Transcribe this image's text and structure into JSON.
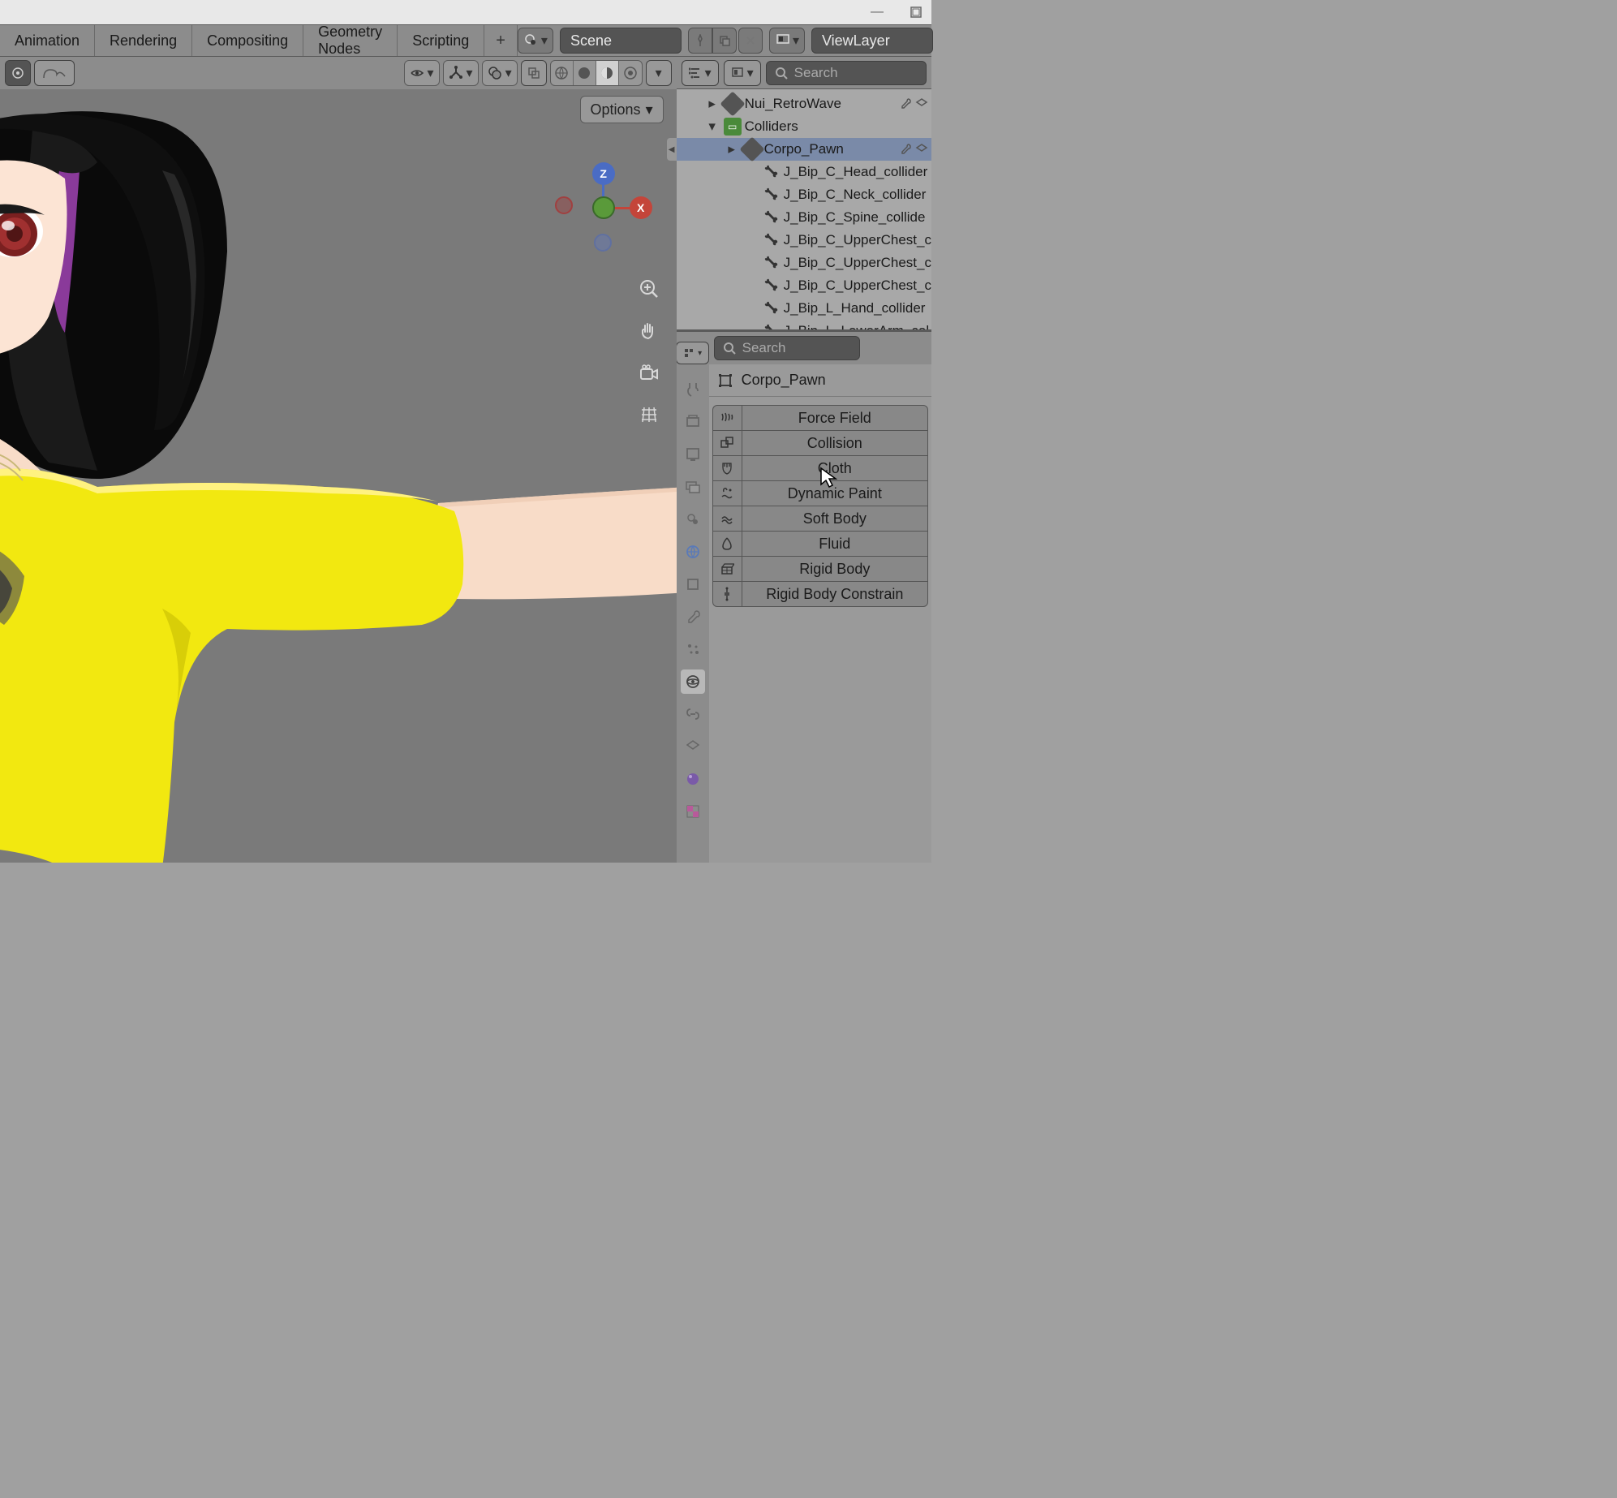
{
  "titlebar": {
    "minimize": "—",
    "maximize": "▢"
  },
  "tabs": [
    "Animation",
    "Rendering",
    "Compositing",
    "Geometry Nodes",
    "Scripting"
  ],
  "add_tab": "+",
  "scene": {
    "label": "Scene",
    "pin": "📌"
  },
  "viewlayer": {
    "label": "ViewLayer"
  },
  "viewport": {
    "options": "Options"
  },
  "outliner": {
    "search_placeholder": "Search",
    "items": [
      {
        "label": "Nui_RetroWave",
        "type": "mesh",
        "indent": 1,
        "arrow": "right"
      },
      {
        "label": "Colliders",
        "type": "collection",
        "indent": 1,
        "arrow": "down"
      },
      {
        "label": "Corpo_Pawn",
        "type": "mesh",
        "indent": 2,
        "arrow": "right",
        "selected": true
      },
      {
        "label": "J_Bip_C_Head_collider",
        "type": "bone",
        "indent": 3
      },
      {
        "label": "J_Bip_C_Neck_collider",
        "type": "bone",
        "indent": 3
      },
      {
        "label": "J_Bip_C_Spine_collide",
        "type": "bone",
        "indent": 3
      },
      {
        "label": "J_Bip_C_UpperChest_c",
        "type": "bone",
        "indent": 3
      },
      {
        "label": "J_Bip_C_UpperChest_c",
        "type": "bone",
        "indent": 3
      },
      {
        "label": "J_Bip_C_UpperChest_c",
        "type": "bone",
        "indent": 3
      },
      {
        "label": "J_Bip_L_Hand_collider",
        "type": "bone",
        "indent": 3
      },
      {
        "label": "J_Bip_L_LowerArm_col",
        "type": "bone",
        "indent": 3
      }
    ]
  },
  "properties": {
    "search_placeholder": "Search",
    "object": "Corpo_Pawn",
    "buttons": [
      "Force Field",
      "Collision",
      "Cloth",
      "Dynamic Paint",
      "Soft Body",
      "Fluid",
      "Rigid Body",
      "Rigid Body Constrain"
    ]
  },
  "axes": {
    "x": "X",
    "z": "Z"
  }
}
